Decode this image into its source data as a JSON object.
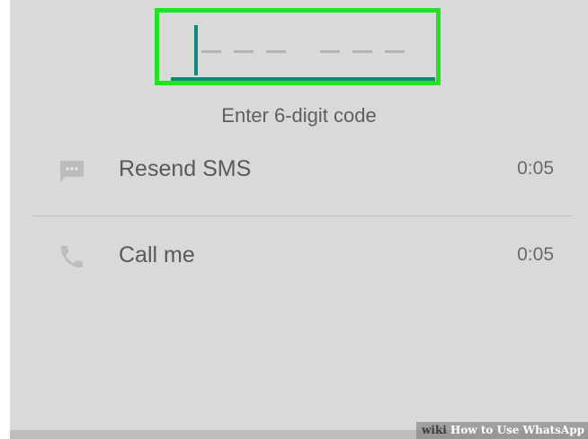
{
  "code_entry": {
    "hint": "Enter 6-digit code",
    "digits": [
      "",
      "",
      "",
      "",
      "",
      ""
    ]
  },
  "options": [
    {
      "icon": "message-icon",
      "label": "Resend SMS",
      "timer": "0:05"
    },
    {
      "icon": "phone-icon",
      "label": "Call me",
      "timer": "0:05"
    }
  ],
  "watermark": {
    "brand": "wiki",
    "title": "How to Use WhatsApp"
  },
  "colors": {
    "accent": "#0e8a7c",
    "highlight": "#22e222",
    "background": "#d9d9d9"
  }
}
